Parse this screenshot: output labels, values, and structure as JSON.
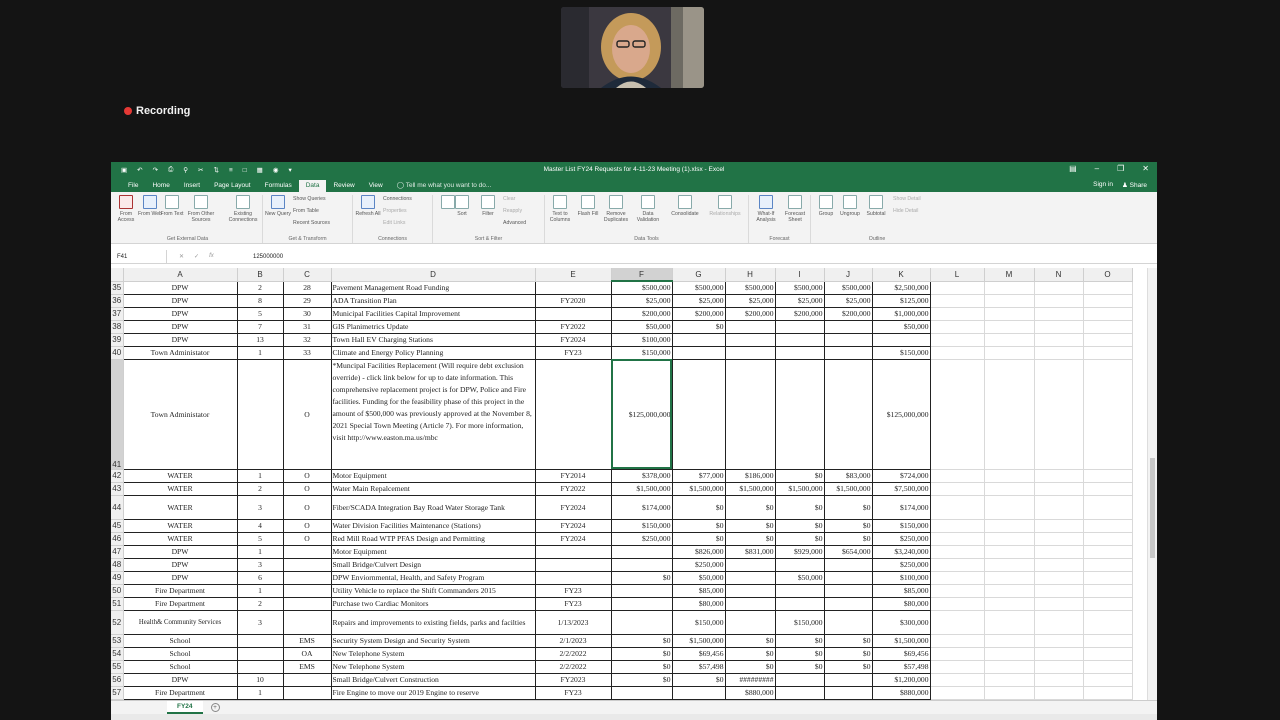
{
  "meeting": {
    "recording_label": "Recording"
  },
  "window": {
    "title": "Master List FY24 Requests for 4-11-23 Meeting (1).xlsx - Excel"
  },
  "menu": {
    "tabs": [
      "File",
      "Home",
      "Insert",
      "Page Layout",
      "Formulas",
      "Data",
      "Review",
      "View"
    ],
    "active": "Data",
    "tell_me": "Tell me what you want to do...",
    "sign_in": "Sign in",
    "share": "Share"
  },
  "ribbon": {
    "get_external_data": {
      "label": "Get External Data",
      "buttons": [
        "From Access",
        "From Web",
        "From Text",
        "From Other Sources",
        "Existing Connections"
      ]
    },
    "get_transform": {
      "label": "Get & Transform",
      "new_query": "New Query",
      "items": [
        "Show Queries",
        "From Table",
        "Recent Sources"
      ]
    },
    "connections": {
      "label": "Connections",
      "refresh": "Refresh All",
      "items": [
        "Connections",
        "Properties",
        "Edit Links"
      ]
    },
    "sort_filter": {
      "label": "Sort & Filter",
      "sort": "Sort",
      "filter": "Filter",
      "items": [
        "Clear",
        "Reapply",
        "Advanced"
      ]
    },
    "data_tools": {
      "label": "Data Tools",
      "buttons": [
        "Text to Columns",
        "Flash Fill",
        "Remove Duplicates",
        "Data Validation",
        "Consolidate",
        "Relationships"
      ]
    },
    "forecast": {
      "label": "Forecast",
      "buttons": [
        "What-If Analysis",
        "Forecast Sheet"
      ]
    },
    "outline": {
      "label": "Outline",
      "buttons": [
        "Group",
        "Ungroup",
        "Subtotal"
      ],
      "items": [
        "Show Detail",
        "Hide Detail"
      ]
    }
  },
  "formula_bar": {
    "name_box": "F41",
    "value": "125000000"
  },
  "columns": [
    "A",
    "B",
    "C",
    "D",
    "E",
    "F",
    "G",
    "H",
    "I",
    "J",
    "K",
    "L",
    "M",
    "N",
    "O"
  ],
  "rows": [
    {
      "n": "35",
      "A": "DPW",
      "B": "2",
      "C": "28",
      "D": "Pavement Management Road Funding",
      "E": "",
      "F": "$500,000",
      "G": "$500,000",
      "H": "$500,000",
      "I": "$500,000",
      "J": "$500,000",
      "K": "$2,500,000"
    },
    {
      "n": "36",
      "A": "DPW",
      "B": "8",
      "C": "29",
      "D": "ADA Transition Plan",
      "E": "FY2020",
      "F": "$25,000",
      "G": "$25,000",
      "H": "$25,000",
      "I": "$25,000",
      "J": "$25,000",
      "K": "$125,000"
    },
    {
      "n": "37",
      "A": "DPW",
      "B": "5",
      "C": "30",
      "D": "Municipal Facilities Capital Improvement",
      "E": "",
      "F": "$200,000",
      "G": "$200,000",
      "H": "$200,000",
      "I": "$200,000",
      "J": "$200,000",
      "K": "$1,000,000"
    },
    {
      "n": "38",
      "A": "DPW",
      "B": "7",
      "C": "31",
      "D": "GIS Planimetrics Update",
      "E": "FY2022",
      "F": "$50,000",
      "G": "$0",
      "H": "",
      "I": "",
      "J": "",
      "K": "$50,000"
    },
    {
      "n": "39",
      "A": "DPW",
      "B": "13",
      "C": "32",
      "D": "Town Hall EV Charging Stations",
      "E": "FY2024",
      "F": "$100,000",
      "G": "",
      "H": "",
      "I": "",
      "J": "",
      "K": ""
    },
    {
      "n": "40",
      "A": "Town Administator",
      "B": "1",
      "C": "33",
      "D": "Climate and Energy Policy Planning",
      "E": "FY23",
      "F": "$150,000",
      "G": "",
      "H": "",
      "I": "",
      "J": "",
      "K": "$150,000"
    },
    {
      "n": "41",
      "A": "Town Administator",
      "B": "",
      "C": "O",
      "D": "*Muncipal Facilities Replacement (Will require debt exclusion override) - click link below for up to date information.  This comprehensive replacement project is for DPW, Police and Fire facilities. Funding for the feasibility phase of this project in the amount of $500,000 was previously approved at the November 8, 2021 Special Town Meeting (Article 7). For more information, visit http://www.easton.ma.us/mbc",
      "E": "",
      "F": "$125,000,000",
      "G": "",
      "H": "",
      "I": "",
      "J": "",
      "K": "$125,000,000",
      "tall": true
    },
    {
      "n": "42",
      "A": "WATER",
      "B": "1",
      "C": "O",
      "D": "Motor Equipment",
      "E": "FY2014",
      "F": "$378,000",
      "G": "$77,000",
      "H": "$186,000",
      "I": "$0",
      "J": "$83,000",
      "K": "$724,000"
    },
    {
      "n": "43",
      "A": "WATER",
      "B": "2",
      "C": "O",
      "D": "Water Main Repalcement",
      "E": "FY2022",
      "F": "$1,500,000",
      "G": "$1,500,000",
      "H": "$1,500,000",
      "I": "$1,500,000",
      "J": "$1,500,000",
      "K": "$7,500,000"
    },
    {
      "n": "44",
      "A": "WATER",
      "B": "3",
      "C": "O",
      "D": "Fiber/SCADA Integration Bay Road Water Storage Tank",
      "E": "FY2024",
      "F": "$174,000",
      "G": "$0",
      "H": "$0",
      "I": "$0",
      "J": "$0",
      "K": "$174,000",
      "two": true
    },
    {
      "n": "45",
      "A": "WATER",
      "B": "4",
      "C": "O",
      "D": "Water Division Facilities Maintenance (Stations)",
      "E": "FY2024",
      "F": "$150,000",
      "G": "$0",
      "H": "$0",
      "I": "$0",
      "J": "$0",
      "K": "$150,000"
    },
    {
      "n": "46",
      "A": "WATER",
      "B": "5",
      "C": "O",
      "D": "Red Mill Road WTP PFAS Design and Permitting",
      "E": "FY2024",
      "F": "$250,000",
      "G": "$0",
      "H": "$0",
      "I": "$0",
      "J": "$0",
      "K": "$250,000"
    },
    {
      "n": "47",
      "A": "DPW",
      "B": "1",
      "C": "",
      "D": "Motor Equipment",
      "E": "",
      "F": "",
      "G": "$826,000",
      "H": "$831,000",
      "I": "$929,000",
      "J": "$654,000",
      "K": "$3,240,000"
    },
    {
      "n": "48",
      "A": "DPW",
      "B": "3",
      "C": "",
      "D": "Small Bridge/Culvert Design",
      "E": "",
      "F": "",
      "G": "$250,000",
      "H": "",
      "I": "",
      "J": "",
      "K": "$250,000"
    },
    {
      "n": "49",
      "A": "DPW",
      "B": "6",
      "C": "",
      "D": "DPW Enviornmental, Health, and Safety Program",
      "E": "",
      "F": "$0",
      "G": "$50,000",
      "H": "",
      "I": "$50,000",
      "J": "",
      "K": "$100,000"
    },
    {
      "n": "50",
      "A": "Fire Department",
      "B": "1",
      "C": "",
      "D": "Utility Vehicle to replace the Shift Commanders 2015",
      "E": "FY23",
      "F": "",
      "G": "$85,000",
      "H": "",
      "I": "",
      "J": "",
      "K": "$85,000"
    },
    {
      "n": "51",
      "A": "Fire Department",
      "B": "2",
      "C": "",
      "D": "Purchase two Cardiac Monitors",
      "E": "FY23",
      "F": "",
      "G": "$80,000",
      "H": "",
      "I": "",
      "J": "",
      "K": "$80,000"
    },
    {
      "n": "52",
      "A": "Health& Community Services",
      "B": "3",
      "C": "",
      "D": "Repairs and improvements to existing fields, parks and facilties",
      "E": "1/13/2023",
      "F": "",
      "G": "$150,000",
      "H": "",
      "I": "$150,000",
      "J": "",
      "K": "$300,000",
      "two": true
    },
    {
      "n": "53",
      "A": "School",
      "B": "",
      "C": "EMS",
      "D": "Security System Design and Security System",
      "E": "2/1/2023",
      "F": "$0",
      "G": "$1,500,000",
      "H": "$0",
      "I": "$0",
      "J": "$0",
      "K": "$1,500,000"
    },
    {
      "n": "54",
      "A": "School",
      "B": "",
      "C": "OA",
      "D": "New Telephone System",
      "E": "2/2/2022",
      "F": "$0",
      "G": "$69,456",
      "H": "$0",
      "I": "$0",
      "J": "$0",
      "K": "$69,456"
    },
    {
      "n": "55",
      "A": "School",
      "B": "",
      "C": "EMS",
      "D": "New Telephone System",
      "E": "2/2/2022",
      "F": "$0",
      "G": "$57,498",
      "H": "$0",
      "I": "$0",
      "J": "$0",
      "K": "$57,498"
    },
    {
      "n": "56",
      "A": "DPW",
      "B": "10",
      "C": "",
      "D": "Small Bridge/Culvert Construction",
      "E": "FY2023",
      "F": "$0",
      "G": "$0",
      "H": "#########",
      "I": "",
      "J": "",
      "K": "$1,200,000"
    },
    {
      "n": "57",
      "A": "Fire Department",
      "B": "1",
      "C": "",
      "D": "Fire Engine to move our 2019 Engine to reserve",
      "E": "FY23",
      "F": "",
      "G": "",
      "H": "$880,000",
      "I": "",
      "J": "",
      "K": "$880,000"
    }
  ],
  "sheet_tab": "FY24"
}
